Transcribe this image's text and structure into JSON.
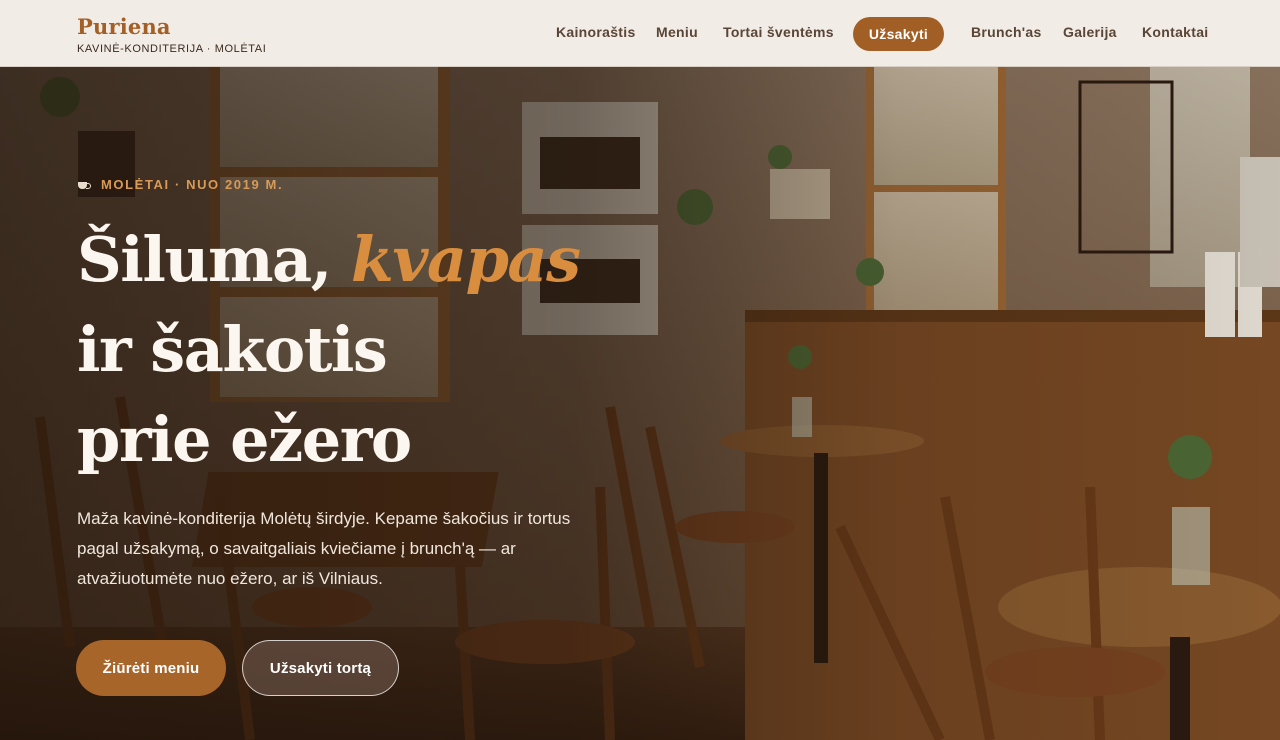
{
  "brand": {
    "name": "Puriena",
    "tagline": "KAVINĖ-KONDITERIJA · MOLĖTAI"
  },
  "nav": {
    "items": [
      "Kainoraštis",
      "Meniu",
      "Tortai šventėms",
      "Brunch'as",
      "Galerija",
      "Kontaktai"
    ],
    "cta": "Užsakyti"
  },
  "hero": {
    "eyebrow": "MOLĖTAI · NUO 2019 M.",
    "eyebrow_icon": "coffee-cup-icon",
    "headline": {
      "line1_plain": "Šiluma, ",
      "line1_accent": "kvapas",
      "line2": "ir šakotis",
      "line3": "prie ežero"
    },
    "lead": "Maža kavinė-konditerija Molėtų širdyje. Kepame šakočius ir tortus pagal užsakymą, o savaitgaliais kviečiame į brunch'ą — ar atvažiuotumėte nuo ežero, ar iš Vilniaus.",
    "primary_button": "Žiūrėti meniu",
    "secondary_button": "Užsakyti tortą"
  },
  "colors": {
    "accent": "#a25f25",
    "accent_text": "#d98d3f",
    "header_bg": "#f1ece6"
  }
}
